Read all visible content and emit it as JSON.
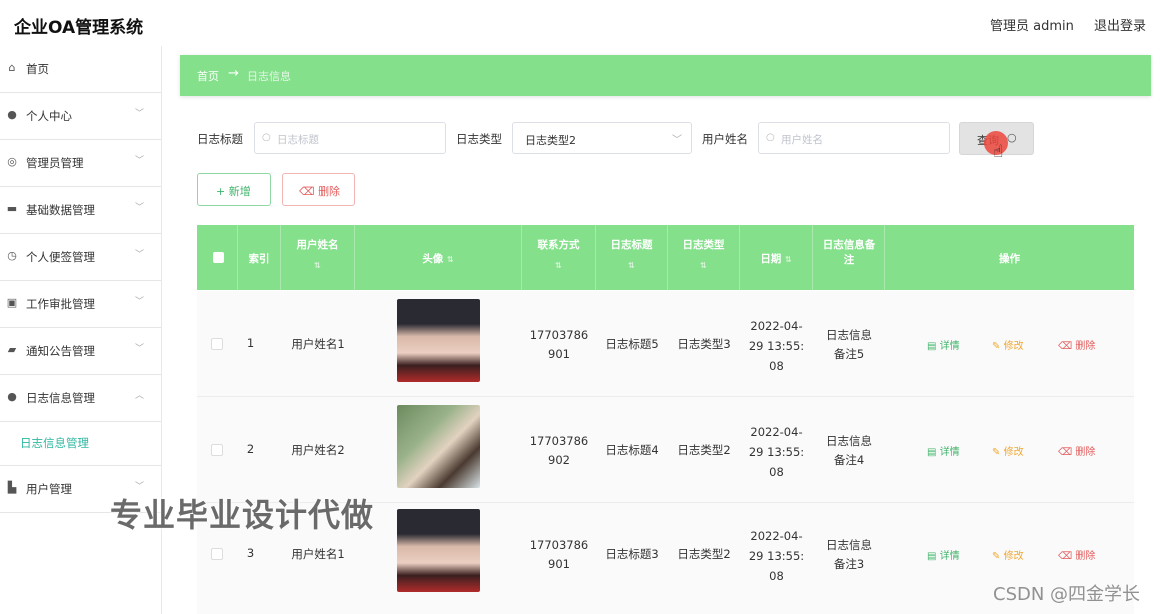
{
  "header": {
    "app_title": "企业OA管理系统",
    "user_label": "管理员 admin",
    "logout_label": "退出登录"
  },
  "sidebar": {
    "items": [
      {
        "label": "首页",
        "icon": "home-icon",
        "glyph": "⌂"
      },
      {
        "label": "个人中心",
        "icon": "person-icon",
        "glyph": "●"
      },
      {
        "label": "管理员管理",
        "icon": "admin-icon",
        "glyph": "◎"
      },
      {
        "label": "基础数据管理",
        "icon": "database-icon",
        "glyph": "▬"
      },
      {
        "label": "个人便签管理",
        "icon": "clock-icon",
        "glyph": "◷"
      },
      {
        "label": "工作审批管理",
        "icon": "approval-icon",
        "glyph": "▣"
      },
      {
        "label": "通知公告管理",
        "icon": "notice-icon",
        "glyph": "▰"
      },
      {
        "label": "日志信息管理",
        "icon": "person-icon",
        "glyph": "●"
      },
      {
        "label": "用户管理",
        "icon": "user-manage-icon",
        "glyph": "▙"
      }
    ],
    "active_sub_label": "日志信息管理",
    "expanded_index": 7
  },
  "breadcrumb": {
    "home": "首页",
    "arrow": "→",
    "current": "日志信息"
  },
  "filters": {
    "title_label": "日志标题",
    "title_placeholder": "日志标题",
    "type_label": "日志类型",
    "type_value": "日志类型2",
    "user_label": "用户姓名",
    "user_placeholder": "用户姓名",
    "query_label": "查询"
  },
  "actions": {
    "add_label": "+ 新增",
    "delete_label": "删除"
  },
  "table": {
    "headers": [
      "",
      "索引",
      "用户姓名",
      "头像",
      "联系方式",
      "日志标题",
      "日志类型",
      "日期",
      "日志信息备注",
      "操作"
    ],
    "sort_glyph": "⇅",
    "row_actions": {
      "detail": "详情",
      "edit": "修改",
      "delete": "删除"
    },
    "rows": [
      {
        "index": "1",
        "name": "用户姓名1",
        "phone_a": "17703786",
        "phone_b": "901",
        "title": "日志标题5",
        "type": "日志类型3",
        "date_a": "2022-04-",
        "date_b": "29 13:55:",
        "date_c": "08",
        "note_a": "日志信息",
        "note_b": "备注5"
      },
      {
        "index": "2",
        "name": "用户姓名2",
        "phone_a": "17703786",
        "phone_b": "902",
        "title": "日志标题4",
        "type": "日志类型2",
        "date_a": "2022-04-",
        "date_b": "29 13:55:",
        "date_c": "08",
        "note_a": "日志信息",
        "note_b": "备注4"
      },
      {
        "index": "3",
        "name": "用户姓名1",
        "phone_a": "17703786",
        "phone_b": "901",
        "title": "日志标题3",
        "type": "日志类型2",
        "date_a": "2022-04-",
        "date_b": "29 13:55:",
        "date_c": "08",
        "note_a": "日志信息",
        "note_b": "备注3"
      }
    ]
  },
  "overlay": {
    "watermark": "专业毕业设计代做",
    "csdn": "CSDN @四金学长"
  },
  "colors": {
    "accent_green": "#84e08b",
    "active_teal": "#2fb7a0",
    "danger": "#e45a5a",
    "warning": "#f0a830"
  }
}
